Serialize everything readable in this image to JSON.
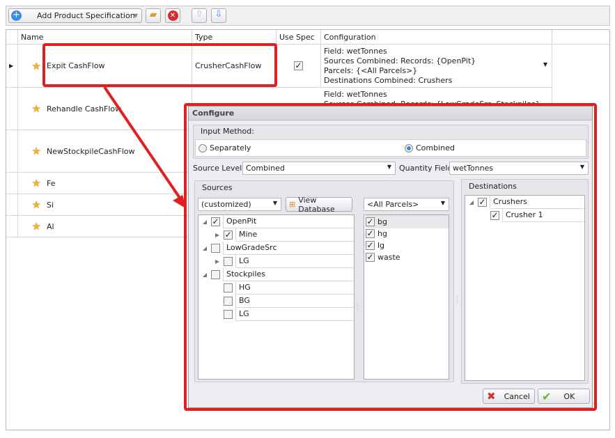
{
  "toolbar": {
    "add_label": "Add Product Specification"
  },
  "grid": {
    "columns": [
      "Name",
      "Type",
      "Use Spec",
      "Configuration"
    ],
    "rows": [
      {
        "name": "Expit CashFlow",
        "type": "CrusherCashFlow",
        "use_spec": true,
        "config": [
          "Field: wetTonnes",
          "Sources Combined: Records: {OpenPit}",
          "Parcels: {<All Parcels>}",
          "Destinations Combined: Crushers"
        ]
      },
      {
        "name": "Rehandle CashFlow",
        "config": [
          "Field: wetTonnes",
          "Sources Combined: Records: {LowGradeSrc, Stockpiles}"
        ]
      },
      {
        "name": "NewStockpileCashFlow"
      },
      {
        "name": "Fe"
      },
      {
        "name": "Si"
      },
      {
        "name": "Al"
      }
    ]
  },
  "dialog": {
    "title": "Configure",
    "input_method_label": "Input Method:",
    "separately": "Separately",
    "combined": "Combined",
    "selected_method": "Combined",
    "source_levels_label": "Source Levels",
    "source_levels_value": "Combined",
    "quantity_field_label": "Quantity Field",
    "quantity_field_value": "wetTonnes",
    "sources_title": "Sources",
    "sources_filter": "(customized)",
    "view_db": "View Database",
    "parcels_filter": "<All Parcels>",
    "source_tree": [
      {
        "label": "OpenPit",
        "level": 0,
        "checked": true,
        "exp": "open"
      },
      {
        "label": "Mine",
        "level": 1,
        "checked": true,
        "exp": "closed"
      },
      {
        "label": "LowGradeSrc",
        "level": 0,
        "checked": false,
        "exp": "open"
      },
      {
        "label": "LG",
        "level": 1,
        "checked": false,
        "exp": "closed"
      },
      {
        "label": "Stockpiles",
        "level": 0,
        "checked": false,
        "exp": "open"
      },
      {
        "label": "HG",
        "level": 1,
        "checked": false,
        "exp": "none"
      },
      {
        "label": "BG",
        "level": 1,
        "checked": false,
        "exp": "none"
      },
      {
        "label": "LG",
        "level": 1,
        "checked": false,
        "exp": "none"
      }
    ],
    "parcels": [
      {
        "label": "bg",
        "checked": true
      },
      {
        "label": "hg",
        "checked": true
      },
      {
        "label": "lg",
        "checked": true
      },
      {
        "label": "waste",
        "checked": true
      }
    ],
    "destinations_title": "Destinations",
    "dest_tree": [
      {
        "label": "Crushers",
        "level": 0,
        "checked": true
      },
      {
        "label": "Crusher 1",
        "level": 1,
        "checked": true
      }
    ],
    "cancel": "Cancel",
    "ok": "OK"
  },
  "colors": {
    "annotation": "#e02020"
  }
}
